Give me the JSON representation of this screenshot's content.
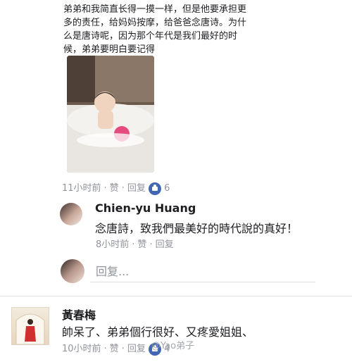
{
  "post_comment": {
    "text": "弟弟和我简直长得一摸一样，但是他要承担更\n多的责任，给妈妈按摩，给爸爸念唐诗。为什\n么是唐诗呢，因为那个年代是我们最好的时\n候，弟弟要明白要记得",
    "time": "11小时前",
    "like": "赞",
    "reply": "回复",
    "reaction_count": "6"
  },
  "replies": [
    {
      "name": "Chien-yu Huang",
      "text": "念唐詩，致我們最美好的時代說的真好！",
      "time": "8小时前",
      "like": "赞",
      "reply": "回复"
    }
  ],
  "reply_input": {
    "placeholder": "回复..."
  },
  "next_comment": {
    "name": "黃春梅",
    "text": "帥呆了、弟弟個行很好、又疼愛姐姐、",
    "time": "10小时前",
    "like": "赞",
    "reply": "回复",
    "reaction_count": "4"
  },
  "watermark": "@Yao弟子",
  "colors": {
    "accent": "#4267b2",
    "meta": "#90949c"
  }
}
